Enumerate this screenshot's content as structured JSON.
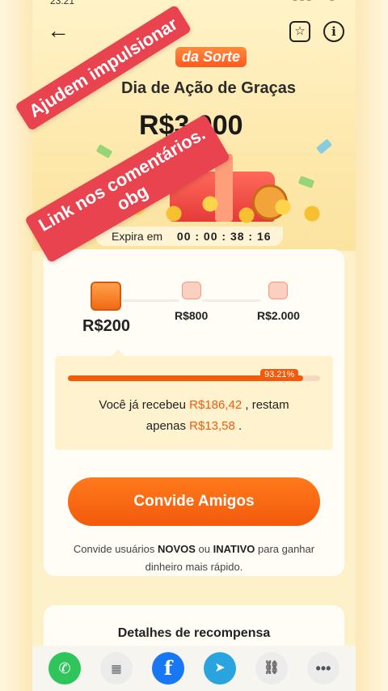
{
  "status_bar": {
    "time": "23:21",
    "icons": "▮▮▮ ◔ ▮"
  },
  "header": {
    "back_icon": "arrow-left-icon",
    "brand": "da Sorte",
    "title": "Dia de Ação de Graças",
    "prize": "R$3.000"
  },
  "timer": {
    "label": "Expira em",
    "value": "00 : 00 : 38 : 16"
  },
  "stages": [
    {
      "label": "R$200"
    },
    {
      "label": "R$800"
    },
    {
      "label": "R$2.000"
    }
  ],
  "progress": {
    "percent": 93.21,
    "percent_label": "93.21%",
    "line1_prefix": "Você já recebeu ",
    "received": "R$186,42",
    "line1_suffix": " , restam",
    "line2_prefix": "apenas ",
    "remaining": "R$13,58",
    "line2_suffix": " ."
  },
  "cta": {
    "label": "Convide Amigos"
  },
  "hint": {
    "part1": "Convide usuários ",
    "bold1": "NOVOS",
    "part2": " ou ",
    "bold2": "INATIVO",
    "part3": " para ganhar",
    "line2": "dinheiro mais rápido."
  },
  "details": {
    "title": "Detalhes de recompensa"
  },
  "share": {
    "whatsapp": "✆",
    "qr": "▦",
    "facebook": "f",
    "telegram": "➤",
    "link": "⛓",
    "more": "•••"
  },
  "stickers": {
    "sticker1": "Ajudem impulsionar",
    "sticker2_line1": "Link nos comentários.",
    "sticker2_line2": "obg"
  },
  "colors": {
    "accent": "#f25a0c",
    "sticker": "#e8434f"
  }
}
